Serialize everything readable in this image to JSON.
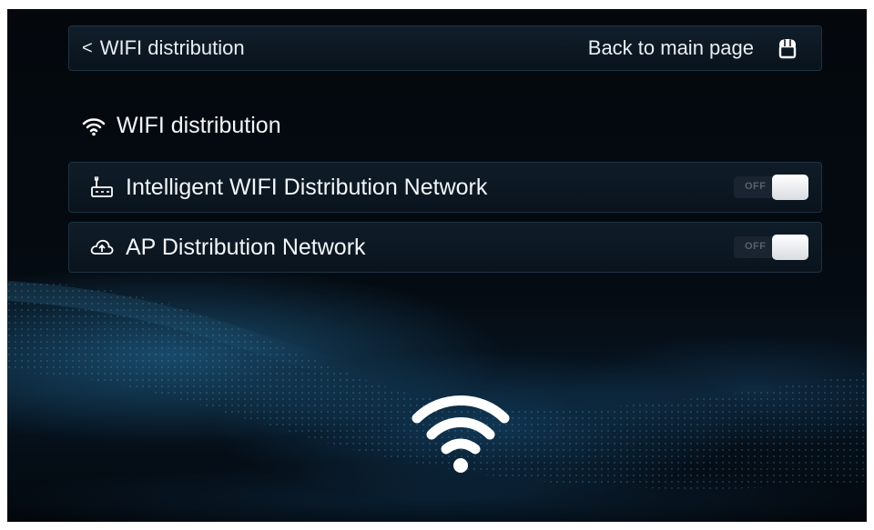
{
  "header": {
    "back_label": "WIFI distribution",
    "main_link_label": "Back to main page",
    "back_icon": "chevron-left-icon",
    "home_icon": "home-icon"
  },
  "section": {
    "title": "WIFI distribution",
    "icon": "wifi-icon"
  },
  "settings": [
    {
      "label": "Intelligent WIFI Distribution Network",
      "icon": "router-icon",
      "toggle_state": "OFF"
    },
    {
      "label": "AP Distribution Network",
      "icon": "cloud-upload-icon",
      "toggle_state": "OFF"
    }
  ],
  "hero_icon": "wifi-icon",
  "colors": {
    "background": "#03070c",
    "panel_border": "#1e3344",
    "text": "#f2f6f9",
    "toggle_knob": "#ffffff",
    "toggle_track": "#1a2330",
    "accent_glow": "#2878aa"
  }
}
